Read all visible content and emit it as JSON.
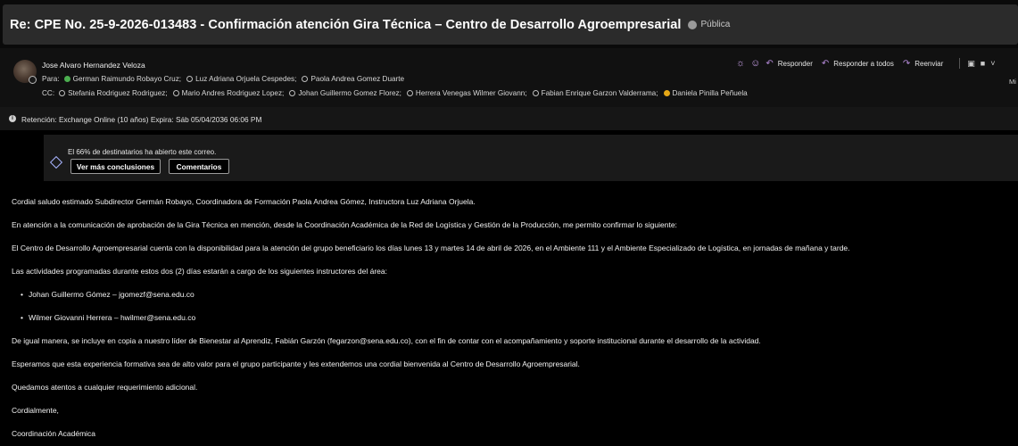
{
  "message": {
    "subject": "Re: CPE No.  25-9-2026-013483 - Confirmación atención Gira Técnica – Centro de Desarrollo Agroempresarial",
    "visibility": "Pública",
    "sender": "Jose Alvaro Hernandez Veloza",
    "to_label": "Para:",
    "to": [
      {
        "name": "German Raimundo Robayo Cruz;",
        "status": "green"
      },
      {
        "name": "Luz Adriana Orjuela Cespedes;",
        "status": "none"
      },
      {
        "name": "Paola Andrea Gomez Duarte",
        "status": "none"
      }
    ],
    "cc_label": "CC:",
    "cc": [
      {
        "name": "Stefania Rodriguez Rodriguez;",
        "status": "none"
      },
      {
        "name": "Mario Andres Rodriguez Lopez;",
        "status": "none"
      },
      {
        "name": "Johan Guillermo Gomez Florez;",
        "status": "none"
      },
      {
        "name": "Herrera Venegas Wilmer Giovann;",
        "status": "none"
      },
      {
        "name": "Fabian Enrique Garzon Valderrama;",
        "status": "none"
      },
      {
        "name": "Daniela Pinilla Peñuela",
        "status": "yellow"
      }
    ],
    "date_truncated": "Mi"
  },
  "toolbar": {
    "reply": "Responder",
    "reply_all": "Responder a todos",
    "forward": "Reenviar",
    "sun_icon": "sun-icon",
    "emoji_icon": "emoji-icon"
  },
  "retention": {
    "text": "Retención: Exchange Online (10 años) Expira: Sáb 05/04/2036 06:06 PM"
  },
  "insights": {
    "text": "El 66% de destinatarios ha abierto este correo.",
    "open_rate_percent": 66,
    "more_button": "Ver más conclusiones",
    "comments_button": "Comentarios"
  },
  "body": {
    "p1": "Cordial saludo estimado Subdirector Germán Robayo, Coordinadora de Formación Paola Andrea Gómez, Instructora Luz Adriana Orjuela.",
    "p2": "En atención a la comunicación de aprobación de la Gira Técnica en mención, desde la Coordinación Académica de la Red de Logística y Gestión de la Producción, me permito confirmar lo siguiente:",
    "p3": "El Centro de Desarrollo Agroempresarial cuenta con la disponibilidad para la atención del grupo beneficiario los días lunes 13 y martes 14 de abril de 2026, en el Ambiente 111 y el Ambiente Especializado de Logística, en jornadas de mañana y tarde.",
    "p4": "Las actividades programadas durante estos dos (2) días estarán a cargo de los siguientes instructores del área:",
    "bullets": [
      "Johan Guillermo Gómez – jgomezf@sena.edu.co",
      "Wilmer Giovanni Herrera – hwilmer@sena.edu.co"
    ],
    "p5": "De igual manera, se incluye en copia a nuestro líder de Bienestar al Aprendiz, Fabián Garzón (fegarzon@sena.edu.co), con el fin de contar con el acompañamiento y soporte institucional durante el desarrollo de la actividad.",
    "p6": "Esperamos que esta experiencia formativa sea de alto valor para el grupo participante y les extendemos una cordial bienvenida al Centro de Desarrollo Agroempresarial.",
    "p7": "Quedamos atentos a cualquier requerimiento adicional.",
    "p8": "Cordialmente,",
    "p9": "Coordinación Académica"
  }
}
